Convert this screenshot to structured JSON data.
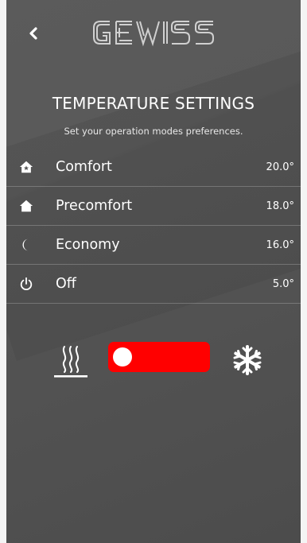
{
  "header": {
    "brand": "GEWISS",
    "back_icon": "chevron-left-icon"
  },
  "page": {
    "title": "TEMPERATURE SETTINGS",
    "subtitle": "Set your operation modes preferences."
  },
  "modes": [
    {
      "label": "Comfort",
      "value": "20.0°",
      "icon": "home-star-icon"
    },
    {
      "label": "Precomfort",
      "value": "18.0°",
      "icon": "home-icon"
    },
    {
      "label": "Economy",
      "value": "16.0°",
      "icon": "moon-icon"
    },
    {
      "label": "Off",
      "value": "5.0°",
      "icon": "power-icon"
    }
  ],
  "season_toggle": {
    "left_icon": "heating-icon",
    "right_icon": "snowflake-icon",
    "selected": "heating",
    "accent_color": "#ff0000"
  }
}
